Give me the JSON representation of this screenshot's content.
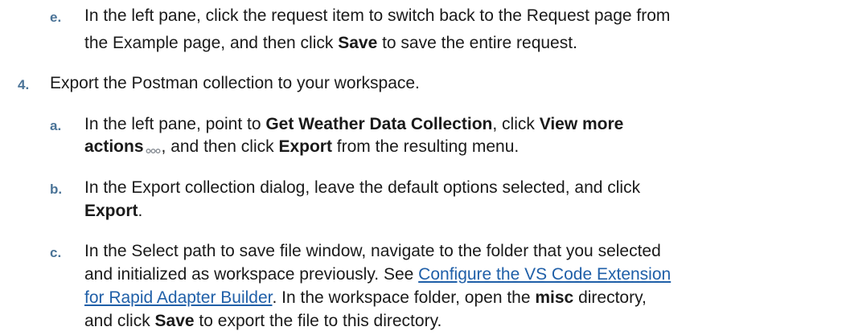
{
  "steps": {
    "e": {
      "marker": "e.",
      "line1": "In the left pane, click the request item to switch back to the Request page from",
      "line2_pre": "the Example page, and then click ",
      "line2_bold": "Save",
      "line2_post": " to save the entire request."
    },
    "step4": {
      "marker": "4.",
      "text": "Export the Postman collection to your workspace."
    },
    "a": {
      "marker": "a.",
      "l1_pre": "In the left pane, point to ",
      "l1_bold1": "Get Weather Data Collection",
      "l1_mid": ", click ",
      "l1_bold2": "View more",
      "l2_bold": "actions",
      "icon": "ellipsis-icon",
      "l2_mid": ", and then click ",
      "l2_bold2": "Export",
      "l2_post": " from the resulting menu."
    },
    "b": {
      "marker": "b.",
      "line1": "In the Export collection dialog, leave the default options selected, and click",
      "line2_bold": "Export",
      "line2_post": "."
    },
    "c": {
      "marker": "c.",
      "line1": "In the Select path to save file window, navigate to the folder that you selected",
      "l2_pre": "and initialized as workspace previously. See ",
      "link_part1": "Configure the VS Code Extension",
      "link_part2": "for Rapid Adapter Builder",
      "l3_post": ". In the workspace folder, open the ",
      "l4_bold_misc": "misc",
      "l4_mid": " directory,",
      "l5_pre": "and click ",
      "l5_bold": "Save",
      "l5_post": " to export the file to this directory."
    }
  },
  "colors": {
    "marker": "#4a7397",
    "link": "#1f5fa8",
    "text": "#1a1a1a"
  }
}
